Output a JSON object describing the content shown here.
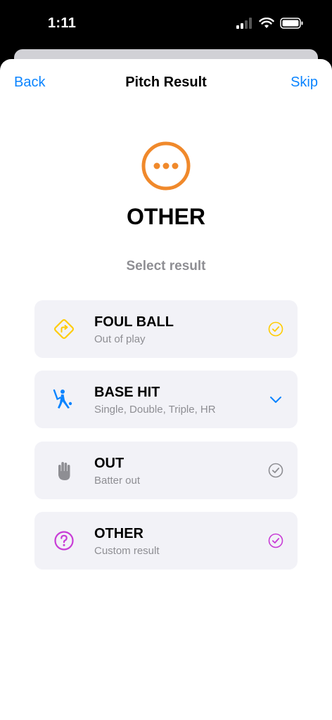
{
  "status_bar": {
    "time": "1:11"
  },
  "nav": {
    "back_label": "Back",
    "title": "Pitch Result",
    "skip_label": "Skip"
  },
  "hero": {
    "icon": "ellipsis-circle-icon",
    "title": "OTHER",
    "accent": "#f0892b"
  },
  "prompt": "Select result",
  "options": [
    {
      "title": "FOUL BALL",
      "subtitle": "Out of play",
      "icon": "diamond-turn-right-icon",
      "color": "#ffcc00",
      "trailing": "check-circle-icon"
    },
    {
      "title": "BASE HIT",
      "subtitle": "Single, Double, Triple, HR",
      "icon": "batter-swing-icon",
      "color": "#0a84ff",
      "trailing": "chevron-down-icon"
    },
    {
      "title": "OUT",
      "subtitle": "Batter out",
      "icon": "hand-raised-icon",
      "color": "#8e8e93",
      "trailing": "check-circle-icon"
    },
    {
      "title": "OTHER",
      "subtitle": "Custom result",
      "icon": "question-circle-icon",
      "color": "#c83cd6",
      "trailing": "check-circle-icon"
    }
  ],
  "colors": {
    "link": "#0a84ff",
    "card_bg": "#f2f2f7",
    "secondary_text": "#8e8e93"
  }
}
